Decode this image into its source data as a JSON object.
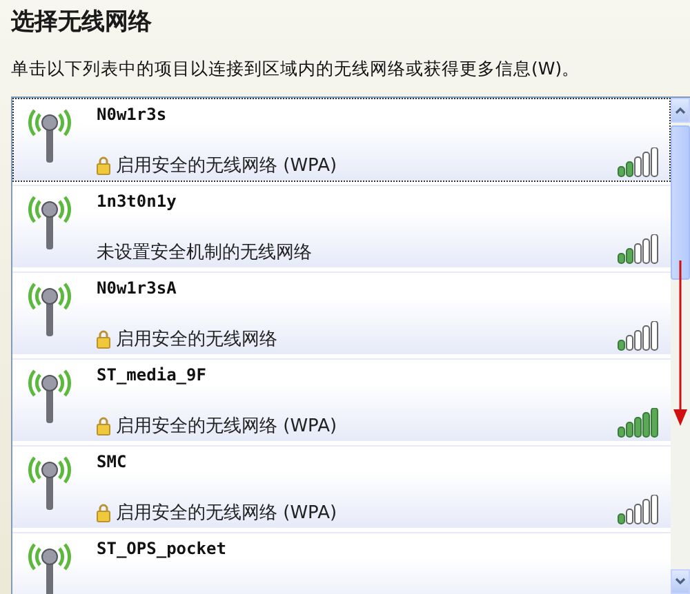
{
  "title": "选择无线网络",
  "instruction": "单击以下列表中的项目以连接到区域内的无线网络或获得更多信息(W)。",
  "networks": [
    {
      "name": "N0w1r3s",
      "secured": true,
      "security": "启用安全的无线网络 (WPA)",
      "level": 0.4,
      "focused": true
    },
    {
      "name": "1n3t0n1y",
      "secured": false,
      "security": "未设置安全机制的无线网络",
      "level": 0.4,
      "focused": false
    },
    {
      "name": "N0w1r3sA",
      "secured": true,
      "security": "启用安全的无线网络",
      "level": 0.2,
      "focused": false
    },
    {
      "name": "ST_media_9F",
      "secured": true,
      "security": "启用安全的无线网络 (WPA)",
      "level": 1,
      "focused": false
    },
    {
      "name": "SMC",
      "secured": true,
      "security": "启用安全的无线网络 (WPA)",
      "level": 0.2,
      "focused": false
    },
    {
      "name": "ST_OPS_pocket",
      "focused": false
    }
  ]
}
